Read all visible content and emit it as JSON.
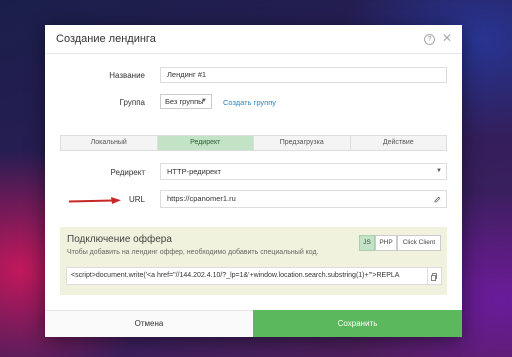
{
  "modal": {
    "title": "Создание лендинга",
    "help_glyph": "?",
    "close_glyph": "✕"
  },
  "form": {
    "name_label": "Название",
    "name_value": "Лендинг #1",
    "group_label": "Группа",
    "group_value": "Без группы",
    "create_group_link": "Создать группу"
  },
  "tabs": [
    {
      "label": "Локальный",
      "active": false
    },
    {
      "label": "Редирект",
      "active": true
    },
    {
      "label": "Предзагрузка",
      "active": false
    },
    {
      "label": "Действие",
      "active": false
    }
  ],
  "redirect": {
    "label": "Редирект",
    "value": "HTTP-редирект"
  },
  "url": {
    "label": "URL",
    "value": "https://cpanomer1.ru",
    "edit_icon": "pencil-icon",
    "annotation_color": "#c62828"
  },
  "offer": {
    "title": "Подключение оффера",
    "subtitle": "Чтобы добавить на лендинг оффер, необходимо добавить специальный код.",
    "langs": [
      {
        "label": "JS",
        "active": true
      },
      {
        "label": "PHP",
        "active": false
      },
      {
        "label": "Click Client",
        "active": false
      }
    ],
    "code": "<script>document.write('<a href=\"//144.202.4.10/?_lp=1&'+window.location.search.substring(1)+'\">REPLA",
    "copy_icon": "copy-icon"
  },
  "footer": {
    "cancel_label": "Отмена",
    "save_label": "Сохранить",
    "save_color": "#5cb85c"
  }
}
